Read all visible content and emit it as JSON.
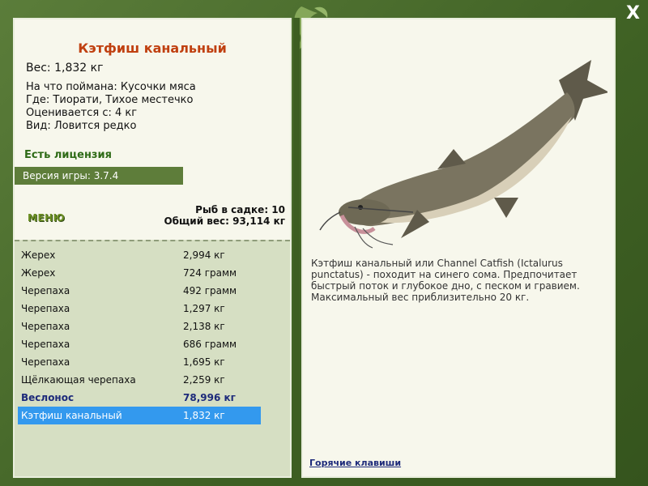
{
  "fish": {
    "name": "Кэтфиш канальный",
    "weight": "Вес: 1,832 кг",
    "caught_on": "На что поймана: Кусочки мяса",
    "location": "Где: Тиорати, Тихое местечко",
    "estimated_from": "Оценивается с: 4 кг",
    "rarity": "Вид: Ловится редко",
    "description": "Кэтфиш канальный или Channel Catfish (Ictalurus punctatus) - походит на синего сома. Предпочитает быстрый поток и глубокое дно, с песком и гравием. Максимальный вес приблизительно 20 кг."
  },
  "license": "Есть лицензия",
  "version": "Версия игры: 3.7.4",
  "menu_label": "МЕНЮ",
  "stats": {
    "fish_in_keepnet": "Рыб в садке: 10",
    "total_weight": "Общий вес: 93,114 кг"
  },
  "catch_list": [
    {
      "name": "Жерех",
      "weight": "2,994 кг"
    },
    {
      "name": "Жерех",
      "weight": "724 грамм"
    },
    {
      "name": "Черепаха",
      "weight": "492 грамм"
    },
    {
      "name": "Черепаха",
      "weight": "1,297 кг"
    },
    {
      "name": "Черепаха",
      "weight": "2,138 кг"
    },
    {
      "name": "Черепаха",
      "weight": "686 грамм"
    },
    {
      "name": "Черепаха",
      "weight": "1,695 кг"
    },
    {
      "name": "Щёлкающая черепаха",
      "weight": "2,259 кг"
    },
    {
      "name": "Веслонос",
      "weight": "78,996 кг"
    },
    {
      "name": "Кэтфиш канальный",
      "weight": "1,832 кг"
    }
  ],
  "hotkeys_label": "Горячие клавиши",
  "close_label": "X",
  "colors": {
    "frame": "#4a6a2e",
    "title": "#c04010",
    "license": "#2f6b17",
    "selected_row": "#3399ee",
    "bold_row": "#1d2a7a"
  }
}
